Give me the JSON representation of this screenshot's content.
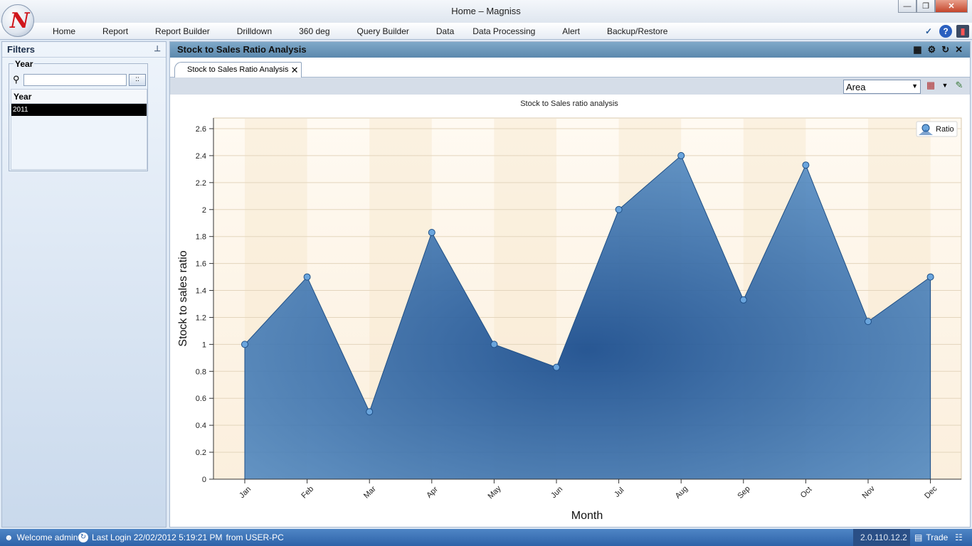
{
  "window": {
    "title": "Home – Magniss",
    "logo_letter": "N"
  },
  "menu": {
    "items": [
      "Home",
      "Report",
      "Report Builder",
      "Drilldown",
      "360 deg",
      "Query Builder",
      "Data",
      "Data Processing",
      "Alert",
      "Backup/Restore"
    ],
    "right_icons": [
      "chevron-down-icon",
      "help-icon",
      "exit-icon"
    ]
  },
  "filters": {
    "title": "Filters",
    "pin_icon": "pin-icon",
    "group_label": "Year",
    "search_placeholder": "",
    "search_button": "::",
    "list_header": "Year",
    "selected_item": "2011"
  },
  "main": {
    "title": "Stock to Sales Ratio Analysis",
    "header_icons": [
      "grid-icon",
      "chart-settings-icon",
      "refresh-icon",
      "close-icon"
    ],
    "tab_label": "Stock to Sales Ratio Analysis",
    "chart_type_select": "Area"
  },
  "chart_data": {
    "type": "area",
    "title": "Stock to Sales ratio analysis",
    "xlabel": "Month",
    "ylabel": "Stock to sales ratio",
    "categories": [
      "Jan",
      "Feb",
      "Mar",
      "Apr",
      "May",
      "Jun",
      "Jul",
      "Aug",
      "Sep",
      "Oct",
      "Nov",
      "Dec"
    ],
    "series": [
      {
        "name": "Ratio",
        "values": [
          1.0,
          1.5,
          0.5,
          1.83,
          1.0,
          0.83,
          2.0,
          2.4,
          1.33,
          2.33,
          1.17,
          1.5
        ]
      }
    ],
    "ylim": [
      0,
      2.6
    ],
    "yticks": [
      "0",
      "0.2",
      "0.4",
      "0.6",
      "0.8",
      "1",
      "1.2",
      "1.4",
      "1.6",
      "1.8",
      "2",
      "2.2",
      "2.4",
      "2.6"
    ],
    "legend": "top-right",
    "grid": true,
    "colors": {
      "area": "#2c68ad",
      "line": "#1f4f86",
      "marker": "#6aa5dd"
    }
  },
  "status": {
    "welcome": "Welcome admin",
    "last_login": "Last Login 22/02/2012 5:19:21 PM",
    "from": "from USER-PC",
    "version": "2.0.110.12.2",
    "mode": "Trade"
  }
}
